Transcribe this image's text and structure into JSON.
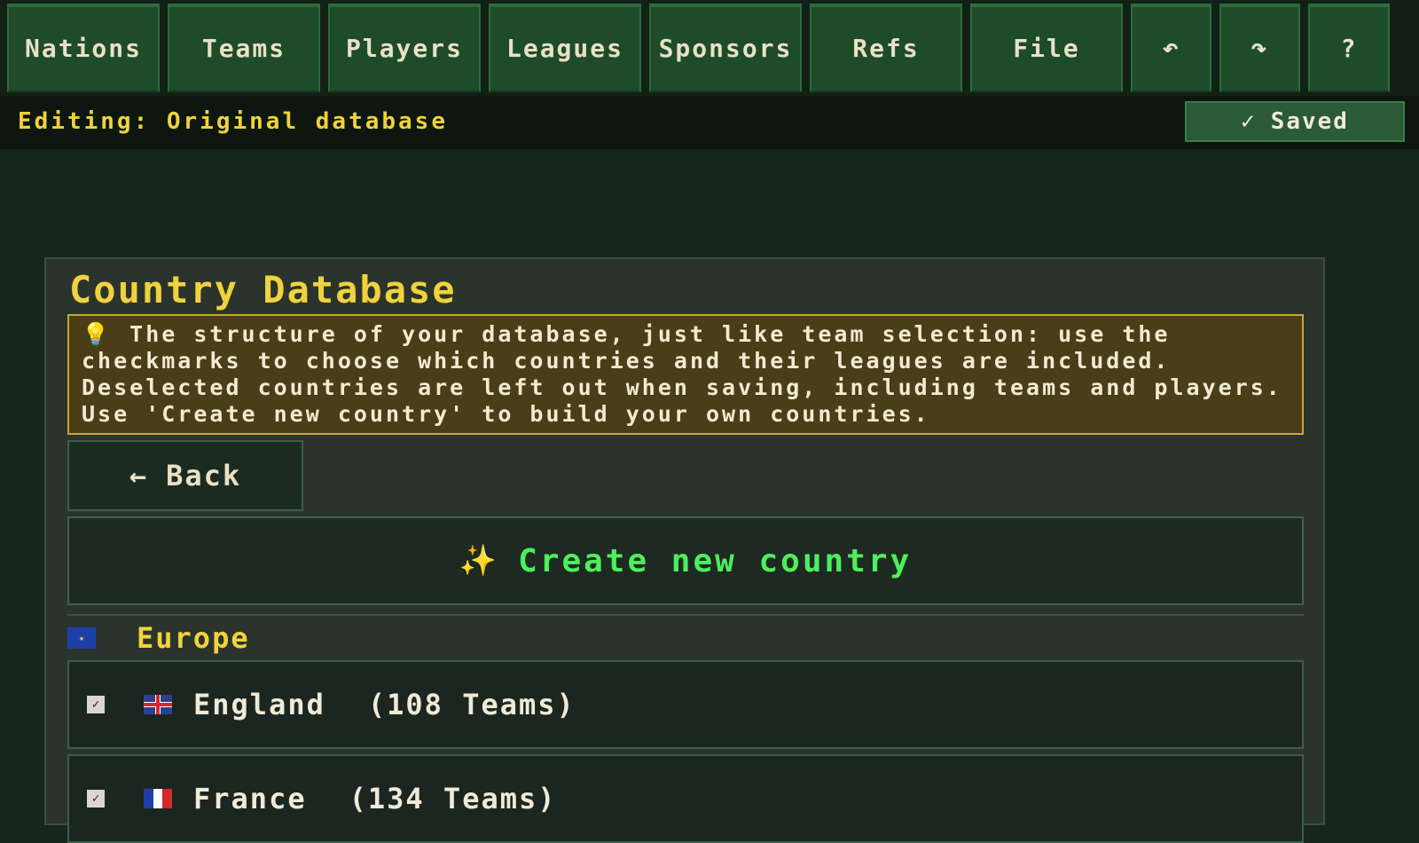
{
  "nav": {
    "nations": "Nations",
    "teams": "Teams",
    "players": "Players",
    "leagues": "Leagues",
    "sponsors": "Sponsors",
    "refs": "Refs",
    "file": "File",
    "undo_glyph": "↶",
    "redo_glyph": "↷",
    "help_glyph": "?"
  },
  "status": {
    "editing": "Editing: Original database",
    "saved_check": "✓",
    "saved_label": "Saved"
  },
  "panel": {
    "title": "Country Database",
    "hint_icon": "💡",
    "hint_text": "The structure of your database, just like team selection: use the checkmarks to choose which countries and their leagues are included. Deselected countries are left out when saving, including teams and players. Use 'Create new country' to build your own countries.",
    "back_arrow": "←",
    "back_label": "Back",
    "create_icon": "✨",
    "create_label": "Create new country"
  },
  "regions": [
    {
      "label": "Europe",
      "flag_icon": "eu-flag-icon",
      "countries": [
        {
          "name": "England",
          "count": "(108 Teams)",
          "checked": true,
          "flag_icon": "uk-flag-icon"
        },
        {
          "name": "France",
          "count": "(134 Teams)",
          "checked": true,
          "flag_icon": "france-flag-icon"
        }
      ]
    }
  ],
  "colors": {
    "accent_yellow": "#f0d23c",
    "accent_green": "#4cef5c",
    "nav_button": "#1e4b2a",
    "background": "#16261a"
  }
}
